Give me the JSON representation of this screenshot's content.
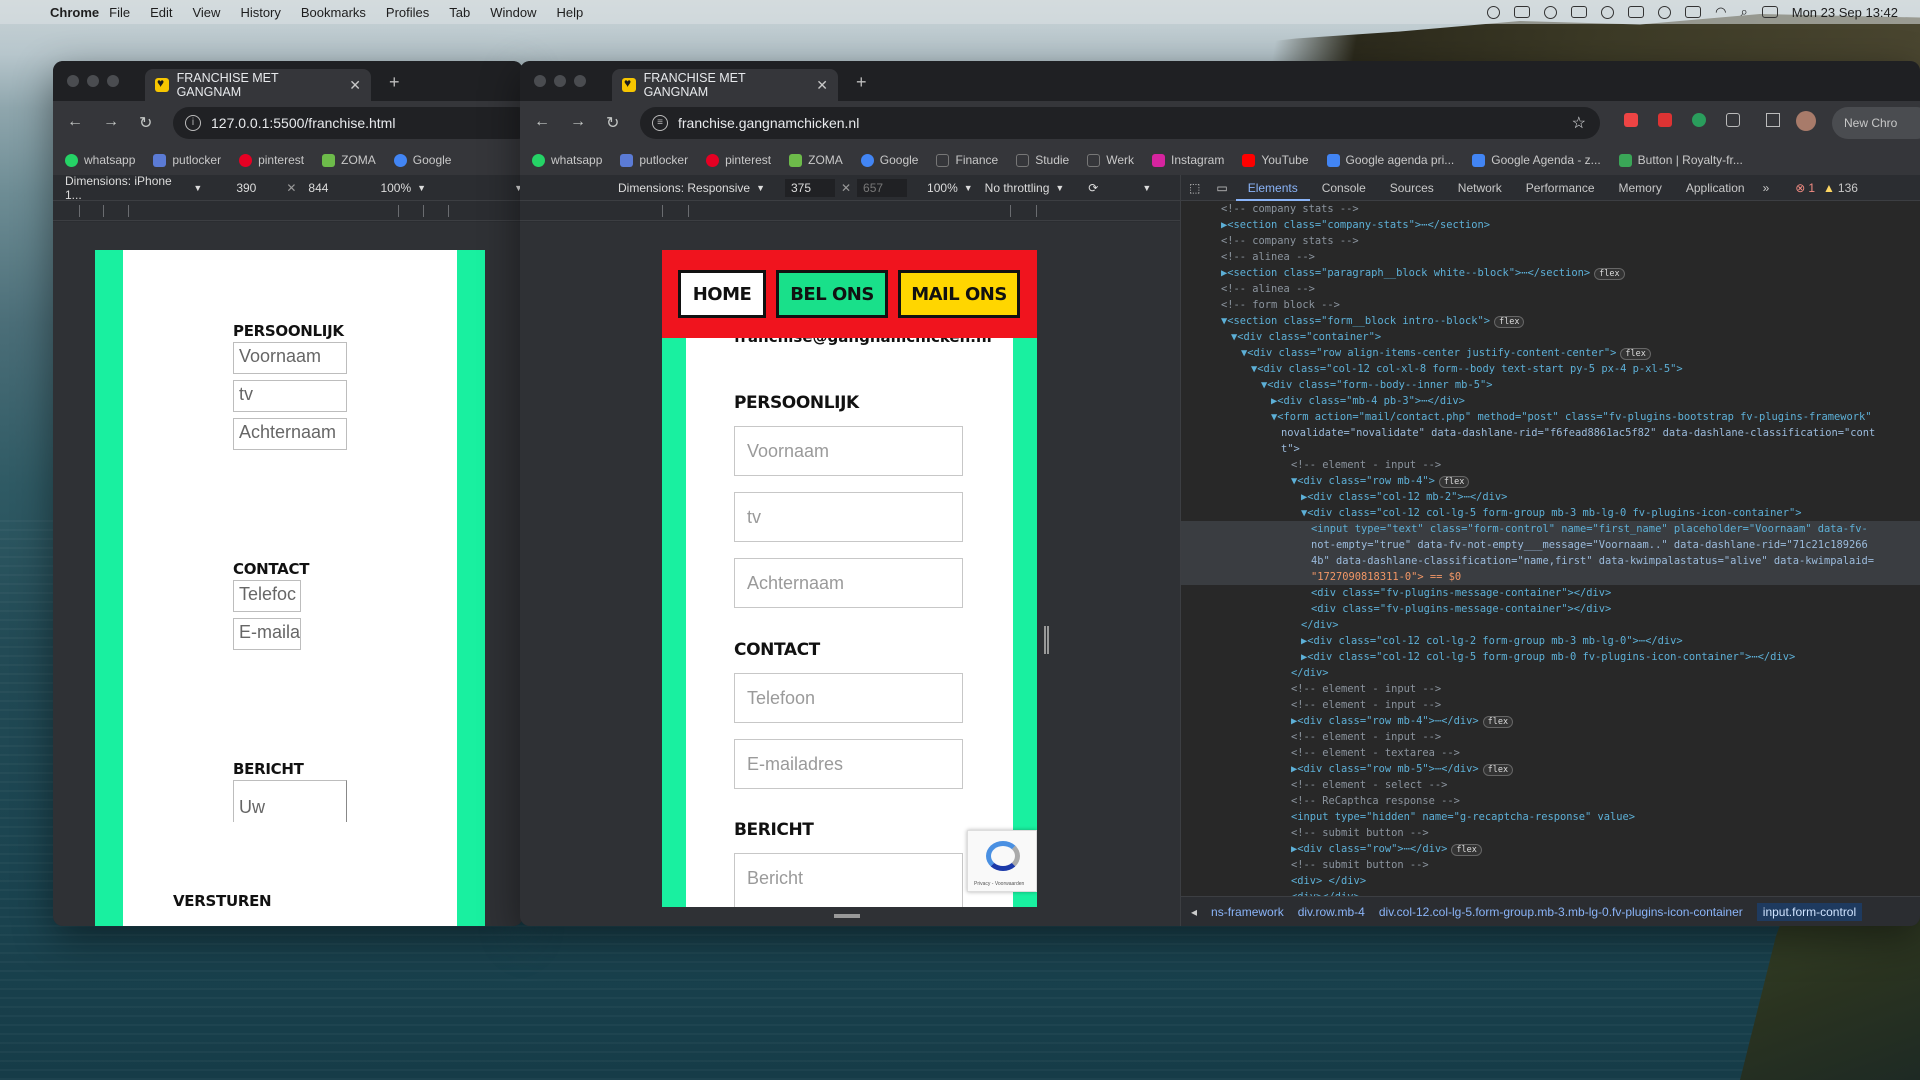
{
  "menubar": {
    "app": "Chrome",
    "items": [
      "File",
      "Edit",
      "View",
      "History",
      "Bookmarks",
      "Profiles",
      "Tab",
      "Window",
      "Help"
    ],
    "clock": "Mon 23 Sep  13:42"
  },
  "windows": {
    "left": {
      "tab_title": "FRANCHISE MET GANGNAM",
      "url": "127.0.0.1:5500/franchise.html",
      "bookmarks": [
        "whatsapp",
        "putlocker",
        "pinterest",
        "ZOMA",
        "Google"
      ],
      "device": {
        "dimensions_label": "Dimensions: iPhone 1...",
        "width": "390",
        "height": "844",
        "zoom": "100%"
      },
      "page": {
        "persoonlijk": "PERSOONLIJK",
        "voornaam": "Voornaam",
        "tv": "tv",
        "achternaam": "Achternaam",
        "contact": "CONTACT",
        "telefoon": "Telefoc",
        "email": "E-maila",
        "bericht": "BERICHT",
        "uw": "Uw",
        "versturen": "VERSTUREN"
      }
    },
    "right": {
      "tab_title": "FRANCHISE MET GANGNAM",
      "url": "franchise.gangnamchicken.nl",
      "bookmarks": [
        "whatsapp",
        "putlocker",
        "pinterest",
        "ZOMA",
        "Google",
        "Finance",
        "Studie",
        "Werk",
        "Instagram",
        "YouTube",
        "Google agenda pri...",
        "Google Agenda - z...",
        "Button | Royalty-fr..."
      ],
      "new_chrome": "New Chro",
      "device": {
        "dimensions_label": "Dimensions: Responsive",
        "width": "375",
        "height": "657",
        "zoom": "100%",
        "throttling": "No throttling"
      },
      "page": {
        "nav": {
          "home": "HOME",
          "bel": "BEL ONS",
          "mail": "MAIL ONS"
        },
        "email_line": "franchise@gangnamchicken.nl",
        "persoonlijk": "PERSOONLIJK",
        "voornaam": "Voornaam",
        "tv": "tv",
        "achternaam": "Achternaam",
        "contact": "CONTACT",
        "telefoon": "Telefoon",
        "emailadres": "E-mailadres",
        "bericht_heading": "BERICHT",
        "bericht": "Bericht",
        "recaptcha_text": "Privacy - Voorwaarden"
      }
    }
  },
  "devtools": {
    "tabs": [
      "Elements",
      "Console",
      "Sources",
      "Network",
      "Performance",
      "Memory",
      "Application"
    ],
    "errors": "1",
    "warnings": "136",
    "breadcrumbs": [
      "ns-framework",
      "div.row.mb-4",
      "div.col-12.col-lg-5.form-group.mb-3.mb-lg-0.fv-plugins-icon-container",
      "input.form-control"
    ],
    "code_lines": [
      {
        "i": 4,
        "h": "<!-- company stats -->",
        "k": "c"
      },
      {
        "i": 4,
        "h": "▶<section class=\"company-stats\">⋯</section>",
        "k": "t"
      },
      {
        "i": 4,
        "h": "<!-- company stats -->",
        "k": "c"
      },
      {
        "i": 4,
        "h": "<!-- alinea -->",
        "k": "c"
      },
      {
        "i": 4,
        "h": "▶<section class=\"paragraph__block white--block\">⋯</section>",
        "k": "t",
        "flex": true
      },
      {
        "i": 4,
        "h": "<!-- alinea -->",
        "k": "c"
      },
      {
        "i": 4,
        "h": "<!-- form block -->",
        "k": "c"
      },
      {
        "i": 4,
        "h": "▼<section class=\"form__block intro--block\">",
        "k": "t",
        "flex": true
      },
      {
        "i": 5,
        "h": "▼<div class=\"container\">",
        "k": "t"
      },
      {
        "i": 6,
        "h": "▼<div class=\"row align-items-center justify-content-center\">",
        "k": "t",
        "flex": true
      },
      {
        "i": 7,
        "h": "▼<div class=\"col-12 col-xl-8 form--body text-start py-5 px-4 p-xl-5\">",
        "k": "t"
      },
      {
        "i": 8,
        "h": "▼<div class=\"form--body--inner mb-5\">",
        "k": "t"
      },
      {
        "i": 9,
        "h": "▶<div class=\"mb-4 pb-3\">⋯</div>",
        "k": "t"
      },
      {
        "i": 9,
        "h": "▼<form action=\"mail/contact.php\" method=\"post\" class=\"fv-plugins-bootstrap fv-plugins-framework\"",
        "k": "t"
      },
      {
        "i": 10,
        "h": "novalidate=\"novalidate\" data-dashlane-rid=\"f6fead8861ac5f82\" data-dashlane-classification=\"cont",
        "k": "a"
      },
      {
        "i": 10,
        "h": "t\">",
        "k": "a"
      },
      {
        "i": 11,
        "h": "<!-- element - input -->",
        "k": "c"
      },
      {
        "i": 11,
        "h": "▼<div class=\"row mb-4\">",
        "k": "t",
        "flex": true
      },
      {
        "i": 12,
        "h": "▶<div class=\"col-12 mb-2\">⋯</div>",
        "k": "t"
      },
      {
        "i": 12,
        "h": "▼<div class=\"col-12 col-lg-5 form-group mb-3 mb-lg-0 fv-plugins-icon-container\">",
        "k": "t"
      },
      {
        "i": 13,
        "h": "<input type=\"text\" class=\"form-control\" name=\"first_name\" placeholder=\"Voornaam\" data-fv-",
        "k": "t",
        "sel": true
      },
      {
        "i": 13,
        "h": "not-empty=\"true\" data-fv-not-empty___message=\"Voornaam..\" data-dashlane-rid=\"71c21c189266",
        "k": "a",
        "sel": true
      },
      {
        "i": 13,
        "h": "4b\" data-dashlane-classification=\"name,first\" data-kwimpalastatus=\"alive\" data-kwimpalaid=",
        "k": "a",
        "sel": true
      },
      {
        "i": 13,
        "h": "\"1727090818311-0\"> == $0",
        "k": "v",
        "sel": true
      },
      {
        "i": 13,
        "h": "<div class=\"fv-plugins-message-container\"></div>",
        "k": "t"
      },
      {
        "i": 13,
        "h": "<div class=\"fv-plugins-message-container\"></div>",
        "k": "t"
      },
      {
        "i": 12,
        "h": "</div>",
        "k": "t"
      },
      {
        "i": 12,
        "h": "▶<div class=\"col-12 col-lg-2 form-group mb-3 mb-lg-0\">⋯</div>",
        "k": "t"
      },
      {
        "i": 12,
        "h": "▶<div class=\"col-12 col-lg-5 form-group mb-0 fv-plugins-icon-container\">⋯</div>",
        "k": "t"
      },
      {
        "i": 11,
        "h": "</div>",
        "k": "t"
      },
      {
        "i": 11,
        "h": "<!-- element - input -->",
        "k": "c"
      },
      {
        "i": 11,
        "h": "<!-- element - input -->",
        "k": "c"
      },
      {
        "i": 11,
        "h": "▶<div class=\"row mb-4\">⋯</div>",
        "k": "t",
        "flex": true
      },
      {
        "i": 11,
        "h": "<!-- element - input -->",
        "k": "c"
      },
      {
        "i": 11,
        "h": "<!-- element - textarea -->",
        "k": "c"
      },
      {
        "i": 11,
        "h": "▶<div class=\"row mb-5\">⋯</div>",
        "k": "t",
        "flex": true
      },
      {
        "i": 11,
        "h": "<!-- element - select -->",
        "k": "c"
      },
      {
        "i": 11,
        "h": "<!-- ReCapthca response -->",
        "k": "c"
      },
      {
        "i": 11,
        "h": "<input type=\"hidden\" name=\"g-recaptcha-response\" value>",
        "k": "t"
      },
      {
        "i": 11,
        "h": "<!-- submit button -->",
        "k": "c"
      },
      {
        "i": 11,
        "h": "▶<div class=\"row\">⋯</div>",
        "k": "t",
        "flex": true
      },
      {
        "i": 11,
        "h": "<!-- submit button -->",
        "k": "c"
      },
      {
        "i": 11,
        "h": "<div> </div>",
        "k": "t"
      },
      {
        "i": 11,
        "h": "<div></div>",
        "k": "t"
      }
    ]
  }
}
